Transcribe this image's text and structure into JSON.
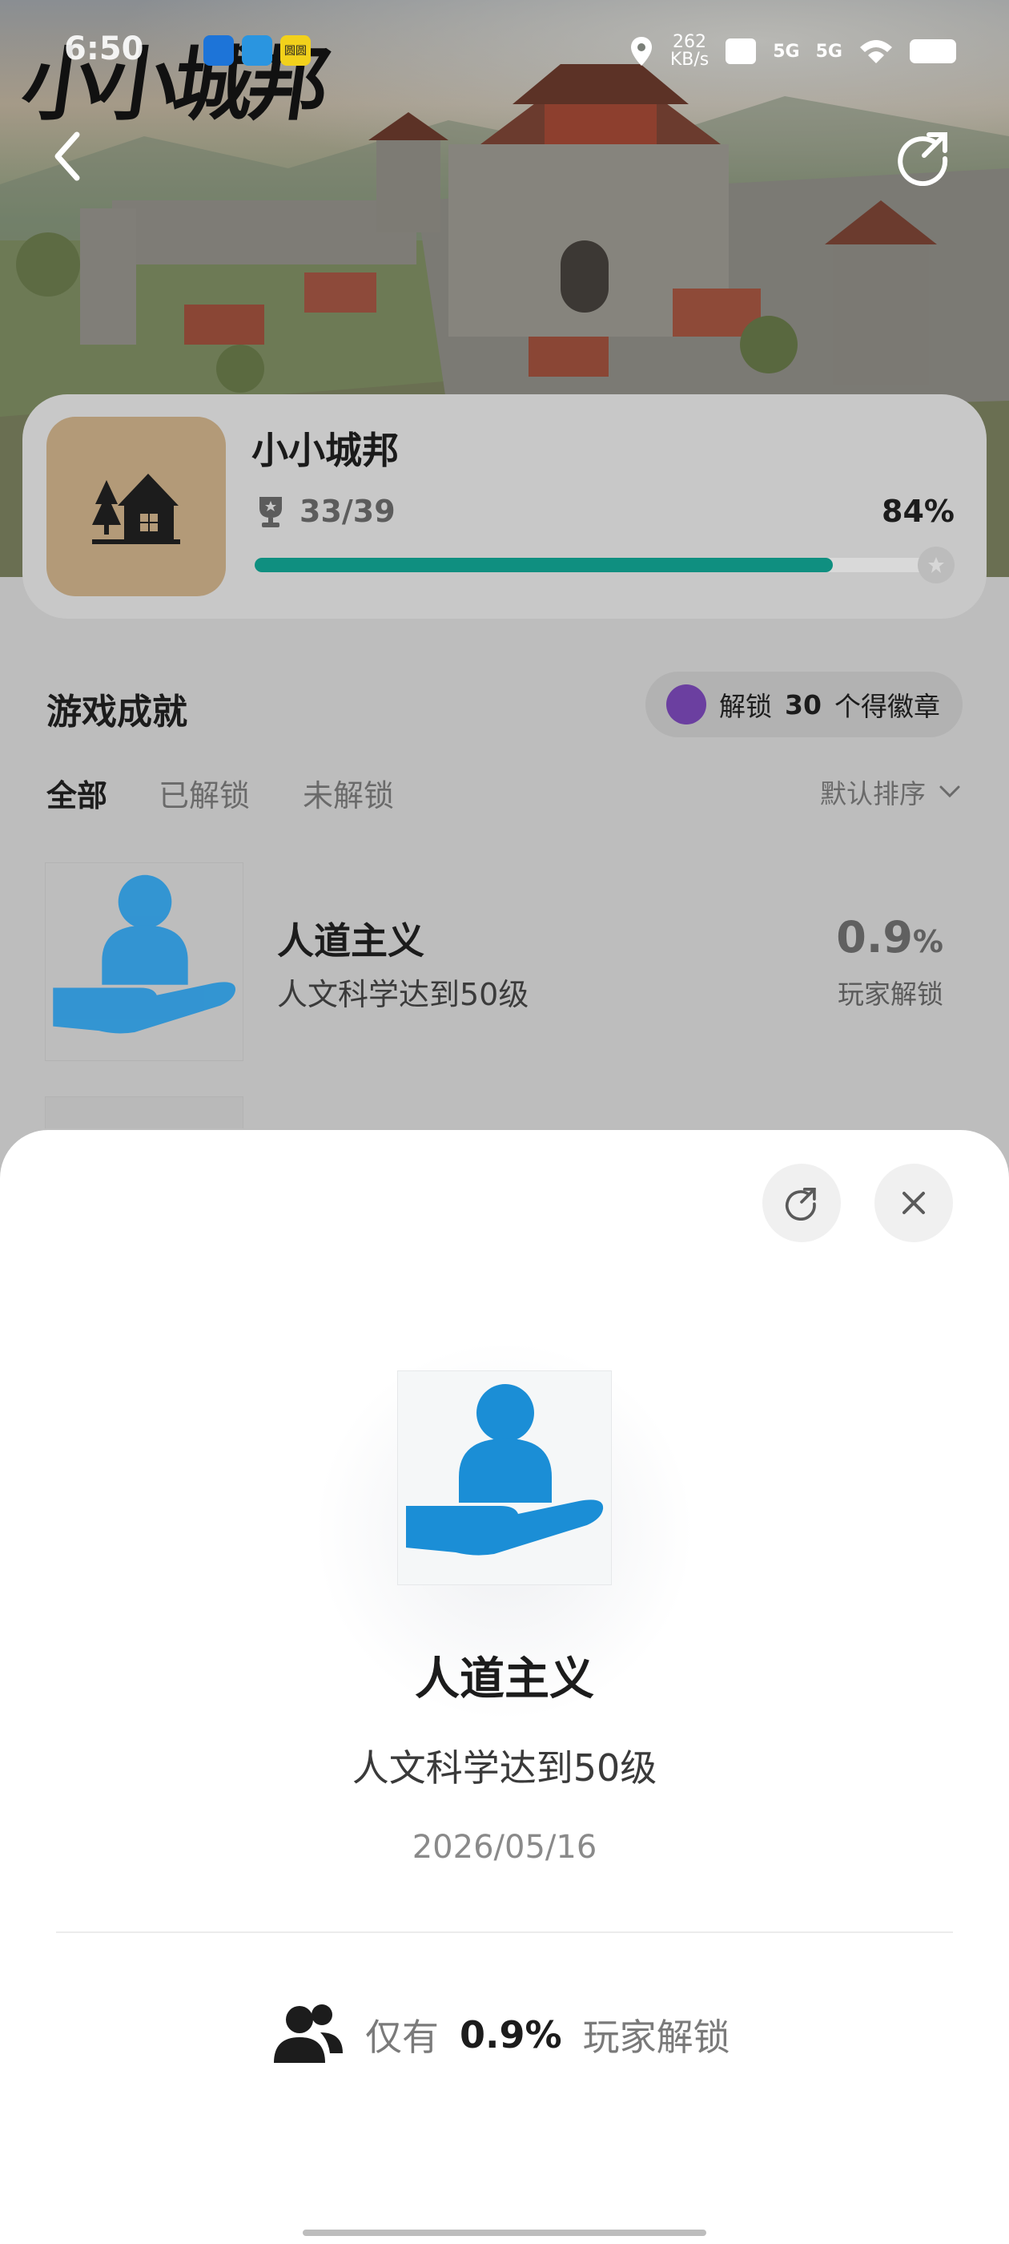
{
  "status_bar": {
    "time": "6:50",
    "speed_value": "262",
    "speed_unit": "KB/s",
    "network_a": "5G",
    "network_b": "5G",
    "app_icon_c": "圆圆"
  },
  "hero": {
    "logo_text": "小小城邦"
  },
  "game": {
    "name": "小小城邦",
    "count": "33/39",
    "percent": "84%",
    "progress_fraction": 0.84,
    "icon": "cabin-trees-icon"
  },
  "achievements": {
    "section_title": "游戏成就",
    "badge_pill": {
      "prefix": "解锁",
      "count": "30",
      "suffix": "个得徽章"
    },
    "tabs": [
      "全部",
      "已解锁",
      "未解锁"
    ],
    "sort_label": "默认排序",
    "items": [
      {
        "title": "人道主义",
        "desc": "人文科学达到50级",
        "rate": "0.9",
        "rate_unit": "%",
        "rate_label": "玩家解锁"
      }
    ]
  },
  "detail_sheet": {
    "title": "人道主义",
    "description": "人文科学达到50级",
    "date": "2026/05/16",
    "stat_prefix": "仅有",
    "stat_value": "0.9%",
    "stat_suffix": "玩家解锁"
  },
  "colors": {
    "progress": "#0f8f80",
    "icon_blue": "#1b8ed6",
    "game_icon_bg": "#b39a78"
  }
}
